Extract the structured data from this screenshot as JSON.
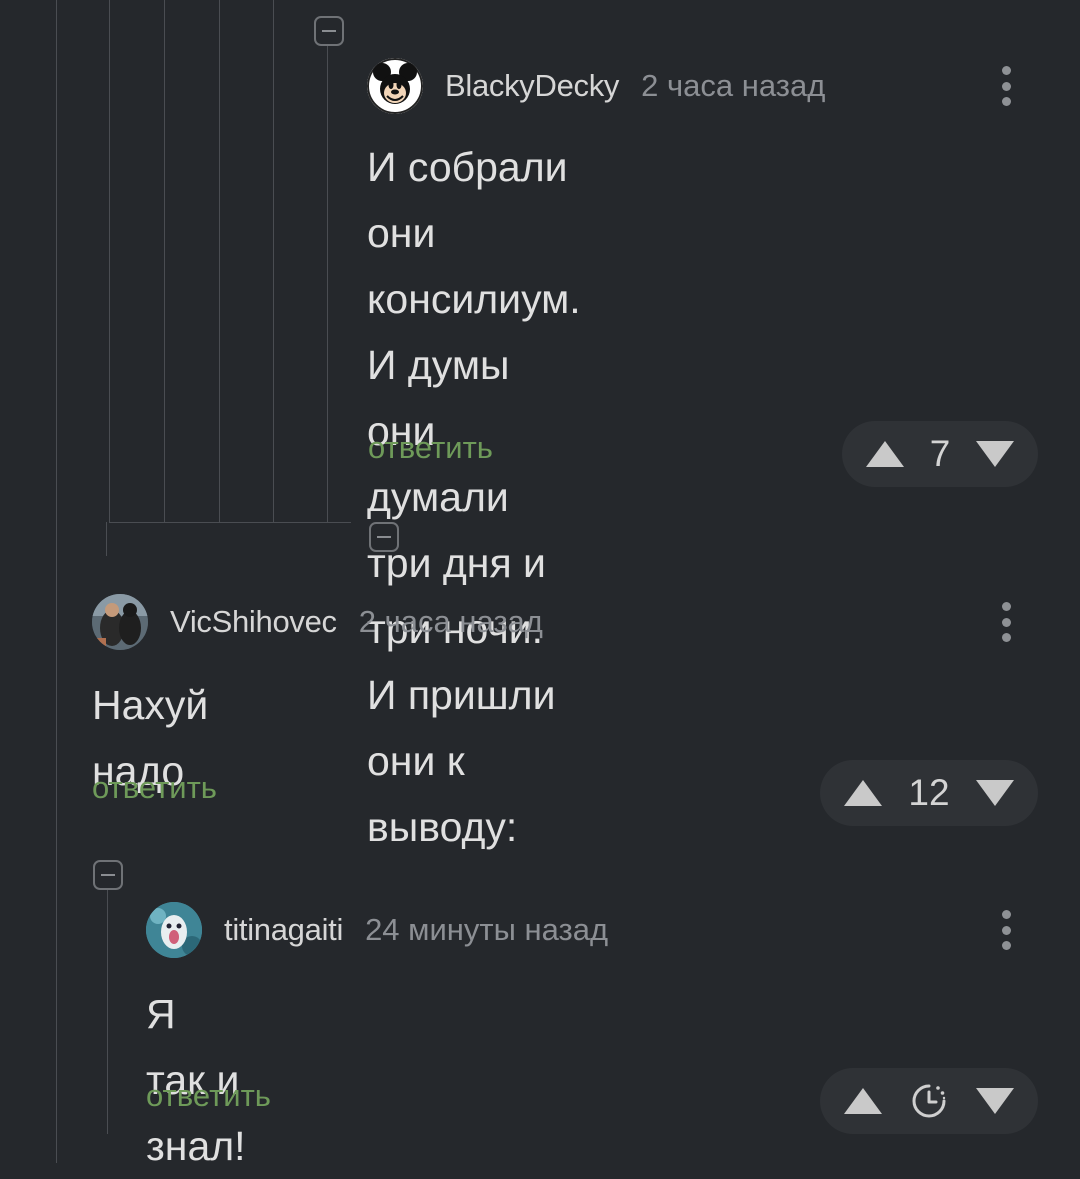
{
  "comments": [
    {
      "username": "BlackyDecky",
      "time": "2 часа назад",
      "lines": [
        "И собрали они консилиум.",
        "И думы они думали три дня и",
        "три ночи.",
        "И пришли они к выводу:"
      ],
      "reply_label": "ответить",
      "votes": "7",
      "avatar_icon": "mickey-mouse-avatar-icon"
    },
    {
      "username": "VicShihovec",
      "time": "2 часа назад",
      "lines": [
        "Нахуй надо"
      ],
      "reply_label": "ответить",
      "votes": "12",
      "avatar_icon": "user-photo-avatar-icon"
    },
    {
      "username": "titinagaiti",
      "time": "24 минуты назад",
      "lines": [
        "Я так и знал!"
      ],
      "reply_label": "ответить",
      "votes": "",
      "vote_pending_icon": "timer-icon",
      "avatar_icon": "user-photo-avatar-icon"
    }
  ],
  "colors": {
    "background": "#25282c",
    "reply_link": "#6e9a59",
    "thread_line": "#4a4d52",
    "vote_pill": "#2f3236"
  },
  "icons": [
    "collapse-minus-icon",
    "more-vertical-icon",
    "upvote-triangle-icon",
    "downvote-triangle-icon",
    "timer-icon"
  ]
}
